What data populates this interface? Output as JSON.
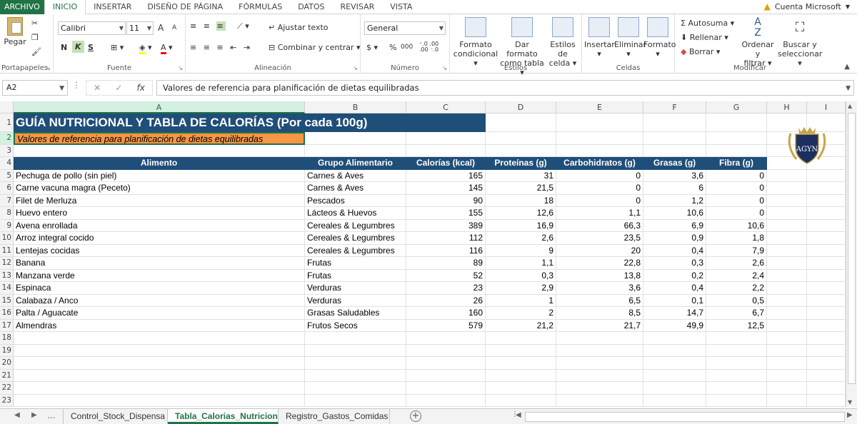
{
  "menu": {
    "tabs": [
      "ARCHIVO",
      "INICIO",
      "INSERTAR",
      "DISEÑO DE PÁGINA",
      "FÓRMULAS",
      "DATOS",
      "REVISAR",
      "VISTA"
    ],
    "account": "Cuenta Microsoft"
  },
  "ribbon": {
    "portapapeles": {
      "label": "Portapapeles",
      "paste": "Pegar"
    },
    "fuente": {
      "label": "Fuente",
      "font": "Calibri",
      "size": "11",
      "bold": "N",
      "italic": "K",
      "underline": "S",
      "grow": "A",
      "shrink": "A"
    },
    "alineacion": {
      "label": "Alineación",
      "wrap": "Ajustar texto",
      "merge": "Combinar y centrar"
    },
    "numero": {
      "label": "Número",
      "format": "General",
      "currency": "$",
      "percent": "%",
      "thousands": "000"
    },
    "estilos": {
      "label": "Estilos",
      "cond1": "Formato",
      "cond2": "condicional",
      "table1": "Dar formato",
      "table2": "como tabla",
      "cell1": "Estilos de",
      "cell2": "celda"
    },
    "celdas": {
      "label": "Celdas",
      "insert": "Insertar",
      "delete": "Eliminar",
      "format": "Formato"
    },
    "modificar": {
      "label": "Modificar",
      "autosum": "Autosuma",
      "fill": "Rellenar",
      "clear": "Borrar",
      "sort1": "Ordenar y",
      "sort2": "filtrar",
      "find1": "Buscar y",
      "find2": "seleccionar"
    }
  },
  "formula_bar": {
    "name_box": "A2",
    "value": "Valores de referencia para planificación de dietas equilibradas"
  },
  "columns": [
    "A",
    "B",
    "C",
    "D",
    "E",
    "F",
    "G",
    "H",
    "I"
  ],
  "sheet": {
    "title": "GUÍA NUTRICIONAL Y TABLA DE CALORÍAS (Por cada 100g)",
    "subtitle": "Valores de referencia para planificación de dietas equilibradas",
    "headers": [
      "Alimento",
      "Grupo Alimentario",
      "Calorías (kcal)",
      "Proteínas (g)",
      "Carbohidratos (g)",
      "Grasas (g)",
      "Fibra (g)"
    ],
    "rows": [
      [
        "Pechuga de pollo (sin piel)",
        "Carnes & Aves",
        "165",
        "31",
        "0",
        "3,6",
        "0"
      ],
      [
        "Carne vacuna magra (Peceto)",
        "Carnes & Aves",
        "145",
        "21,5",
        "0",
        "6",
        "0"
      ],
      [
        "Filet de Merluza",
        "Pescados",
        "90",
        "18",
        "0",
        "1,2",
        "0"
      ],
      [
        "Huevo entero",
        "Lácteos & Huevos",
        "155",
        "12,6",
        "1,1",
        "10,6",
        "0"
      ],
      [
        "Avena enrollada",
        "Cereales & Legumbres",
        "389",
        "16,9",
        "66,3",
        "6,9",
        "10,6"
      ],
      [
        "Arroz integral cocido",
        "Cereales & Legumbres",
        "112",
        "2,6",
        "23,5",
        "0,9",
        "1,8"
      ],
      [
        "Lentejas cocidas",
        "Cereales & Legumbres",
        "116",
        "9",
        "20",
        "0,4",
        "7,9"
      ],
      [
        "Banana",
        "Frutas",
        "89",
        "1,1",
        "22,8",
        "0,3",
        "2,6"
      ],
      [
        "Manzana verde",
        "Frutas",
        "52",
        "0,3",
        "13,8",
        "0,2",
        "2,4"
      ],
      [
        "Espinaca",
        "Verduras",
        "23",
        "2,9",
        "3,6",
        "0,4",
        "2,2"
      ],
      [
        "Calabaza / Anco",
        "Verduras",
        "26",
        "1",
        "6,5",
        "0,1",
        "0,5"
      ],
      [
        "Palta / Aguacate",
        "Grasas Saludables",
        "160",
        "2",
        "8,5",
        "14,7",
        "6,7"
      ],
      [
        "Almendras",
        "Frutos Secos",
        "579",
        "21,2",
        "21,7",
        "49,9",
        "12,5"
      ]
    ],
    "row_numbers": [
      "1",
      "2",
      "3",
      "4",
      "5",
      "6",
      "7",
      "8",
      "9",
      "10",
      "11",
      "12",
      "13",
      "14",
      "15",
      "16",
      "17",
      "18",
      "19",
      "20",
      "21",
      "22",
      "23"
    ]
  },
  "logo": {
    "text": "AGYN",
    "colors": {
      "navy": "#1c2f5e",
      "gold": "#c9a24a"
    }
  },
  "tabs": {
    "sheets": [
      "Control_Stock_Dispensa",
      "Tabla_Calorias_Nutricion",
      "Registro_Gastos_Comidas"
    ],
    "active": "Tabla_Calorias_Nutricion",
    "ellipsis": "..."
  },
  "colors": {
    "accent": "#217346",
    "header_bg": "#1f4e79",
    "subtitle_bg": "#f79646"
  }
}
